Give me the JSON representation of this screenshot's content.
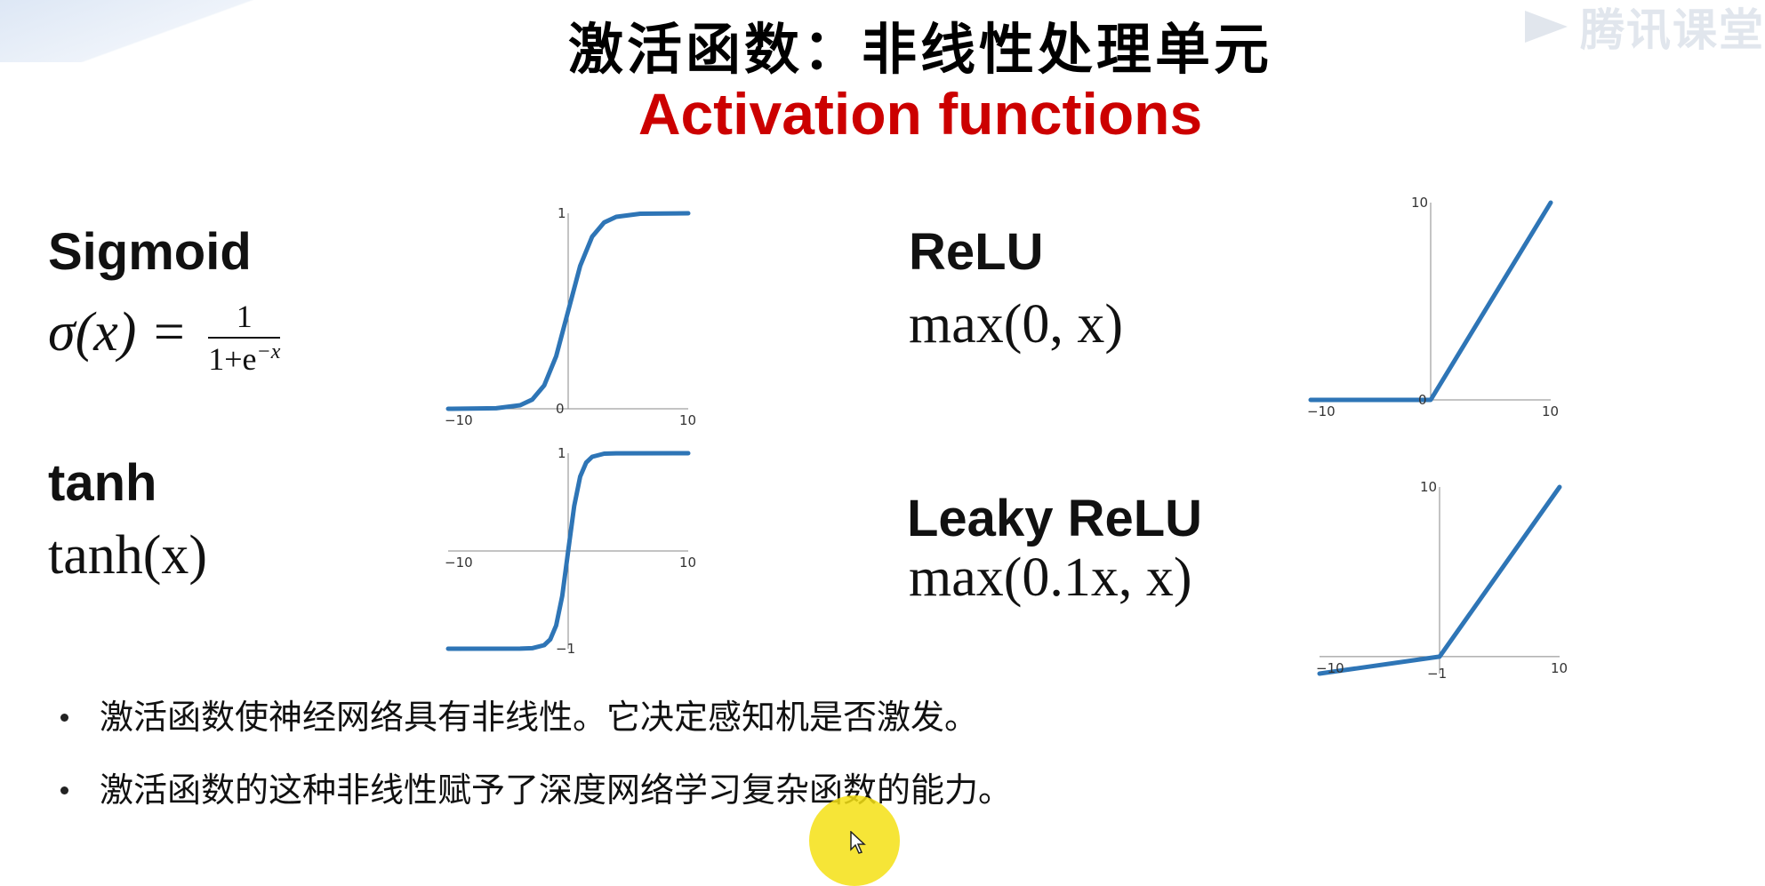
{
  "slide": {
    "title_cn": "激活函数：非线性处理单元",
    "title_en": "Activation functions",
    "title_en_color": "#cc0000",
    "watermark_text": "腾讯课堂",
    "watermark_icon": "play-icon"
  },
  "functions": [
    {
      "name": "Sigmoid"
    },
    {
      "name": "ReLU",
      "formula": "max(0, x)"
    },
    {
      "name": "tanh",
      "formula": "tanh(x)"
    },
    {
      "name": "Leaky ReLU",
      "formula": "max(0.1x, x)"
    }
  ],
  "sigmoid_formula": {
    "lhs": "σ(x) =",
    "numerator": "1",
    "denominator_base": "1+e",
    "denominator_exp": "−x"
  },
  "bullets": [
    "激活函数使神经网络具有非线性。它决定感知机是否激发。",
    "激活函数的这种非线性赋予了深度网络学习复杂函数的能力。"
  ],
  "chart_data": [
    {
      "type": "line",
      "function": "sigmoid",
      "xlim": [
        -10,
        10
      ],
      "ylim": [
        0,
        1
      ],
      "xticks": [
        "−10",
        "10"
      ],
      "yticks": [
        "0",
        "1"
      ],
      "line_color": "#2e75b6",
      "x": [
        -10,
        -6,
        -4,
        -3,
        -2,
        -1,
        0,
        1,
        2,
        3,
        4,
        6,
        10
      ],
      "y": [
        5e-05,
        0.0025,
        0.018,
        0.047,
        0.119,
        0.269,
        0.5,
        0.731,
        0.881,
        0.953,
        0.982,
        0.9975,
        0.99995
      ]
    },
    {
      "type": "line",
      "function": "relu",
      "xlim": [
        -10,
        10
      ],
      "ylim": [
        0,
        10
      ],
      "xticks": [
        "−10",
        "10"
      ],
      "yticks": [
        "0",
        "10"
      ],
      "line_color": "#2e75b6",
      "x": [
        -10,
        0,
        10
      ],
      "y": [
        0,
        0,
        10
      ]
    },
    {
      "type": "line",
      "function": "tanh",
      "xlim": [
        -10,
        10
      ],
      "ylim": [
        -1,
        1
      ],
      "xticks": [
        "−10",
        "10"
      ],
      "yticks": [
        "−1",
        "1"
      ],
      "line_color": "#2e75b6",
      "x": [
        -10,
        -4,
        -3,
        -2,
        -1.5,
        -1,
        -0.5,
        0,
        0.5,
        1,
        1.5,
        2,
        3,
        4,
        10
      ],
      "y": [
        -1,
        -0.9993,
        -0.995,
        -0.964,
        -0.905,
        -0.762,
        -0.462,
        0,
        0.462,
        0.762,
        0.905,
        0.964,
        0.995,
        0.9993,
        1
      ]
    },
    {
      "type": "line",
      "function": "leaky_relu",
      "xlim": [
        -10,
        10
      ],
      "ylim": [
        -1,
        10
      ],
      "xticks": [
        "−10",
        "10"
      ],
      "yticks": [
        "−1",
        "10"
      ],
      "line_color": "#2e75b6",
      "x": [
        -10,
        0,
        10
      ],
      "y": [
        -1,
        0,
        10
      ]
    }
  ]
}
